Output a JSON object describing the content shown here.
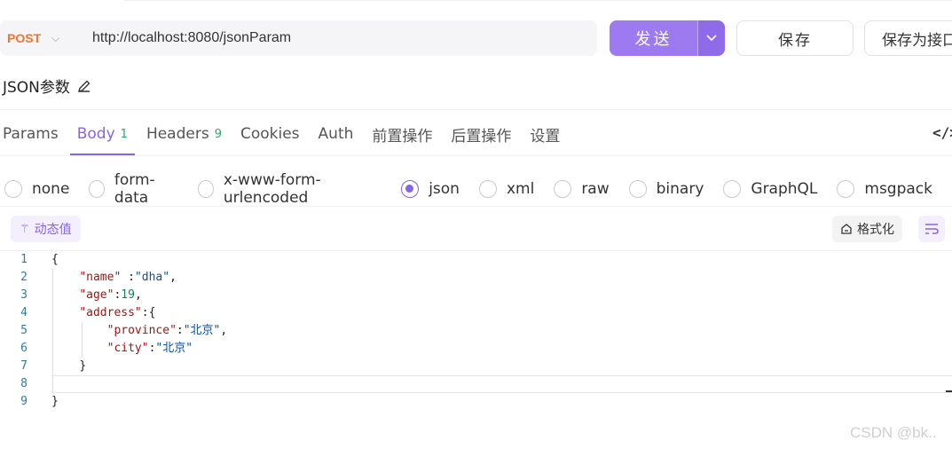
{
  "request": {
    "method": "POST",
    "url": "http://localhost:8080/jsonParam",
    "send_label": "发送",
    "save_label": "保存",
    "save_as_label": "保存为接口"
  },
  "doc": {
    "name": "JSON参数"
  },
  "tabs": [
    {
      "label": "Params",
      "badge": ""
    },
    {
      "label": "Body",
      "badge": "1",
      "active": true
    },
    {
      "label": "Headers",
      "badge": "9"
    },
    {
      "label": "Cookies",
      "badge": ""
    },
    {
      "label": "Auth",
      "badge": ""
    },
    {
      "label": "前置操作",
      "badge": ""
    },
    {
      "label": "后置操作",
      "badge": ""
    },
    {
      "label": "设置",
      "badge": ""
    }
  ],
  "code_toggle": "</>",
  "body_types": [
    {
      "label": "none"
    },
    {
      "label": "form-data"
    },
    {
      "label": "x-www-form-urlencoded"
    },
    {
      "label": "json",
      "checked": true
    },
    {
      "label": "xml"
    },
    {
      "label": "raw"
    },
    {
      "label": "binary"
    },
    {
      "label": "GraphQL"
    },
    {
      "label": "msgpack"
    }
  ],
  "tools": {
    "dynamic_value": "动态值",
    "format": "格式化"
  },
  "editor": {
    "line_numbers": [
      "1",
      "2",
      "3",
      "4",
      "5",
      "6",
      "7",
      "8",
      "9"
    ],
    "tokens": {
      "open_brace": "{",
      "close_brace": "}",
      "name_key": "\"name\"",
      "name_sep": " :",
      "name_val": "\"dha\"",
      "age_key": "\"age\"",
      "age_val": "19",
      "address_key": "\"address\"",
      "province_key": "\"province\"",
      "province_val": "\"北京\"",
      "city_key": "\"city\"",
      "city_val": "\"北京\""
    }
  },
  "watermark": "CSDN @bk..",
  "colors": {
    "accent": "#8a63e5",
    "send_button": "#9d7af0",
    "method": "#f5742a",
    "badge": "#2aa86a"
  }
}
